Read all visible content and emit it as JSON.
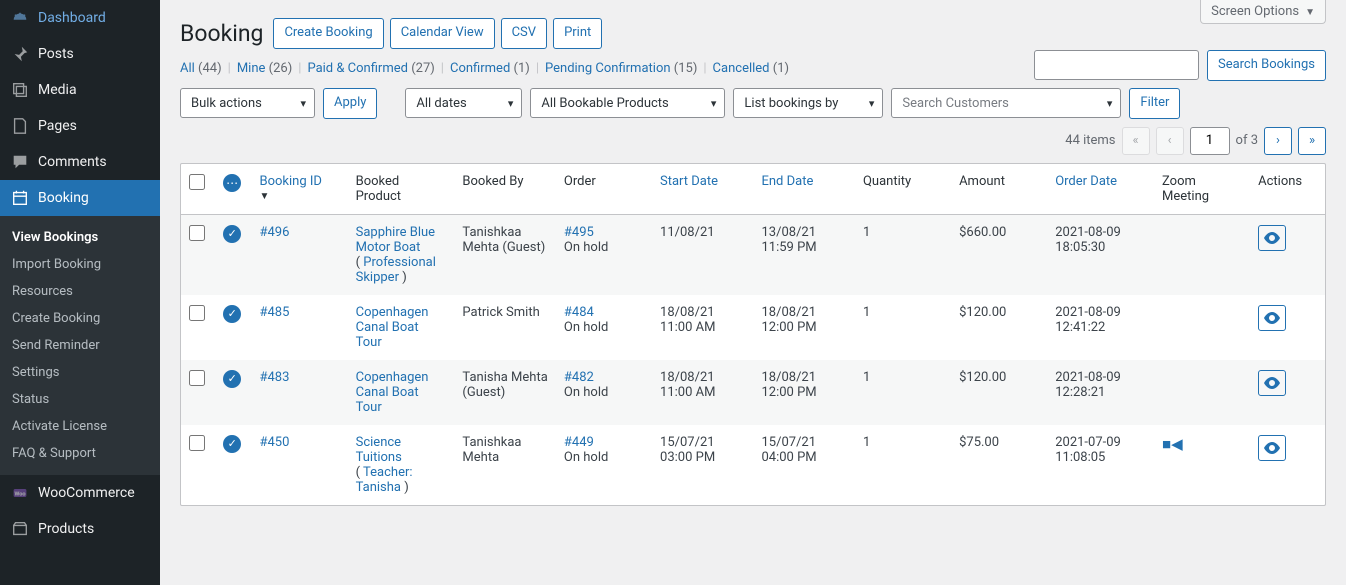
{
  "screen_options": "Screen Options",
  "sidebar": {
    "items": [
      {
        "label": "Dashboard",
        "icon": "dashboard"
      },
      {
        "label": "Posts",
        "icon": "pin"
      },
      {
        "label": "Media",
        "icon": "media"
      },
      {
        "label": "Pages",
        "icon": "pages"
      },
      {
        "label": "Comments",
        "icon": "comments"
      },
      {
        "label": "Booking",
        "icon": "calendar",
        "active": true
      },
      {
        "label": "WooCommerce",
        "icon": "woo"
      },
      {
        "label": "Products",
        "icon": "products"
      }
    ],
    "sub": [
      {
        "label": "View Bookings",
        "active": true
      },
      {
        "label": "Import Booking"
      },
      {
        "label": "Resources"
      },
      {
        "label": "Create Booking"
      },
      {
        "label": "Send Reminder"
      },
      {
        "label": "Settings"
      },
      {
        "label": "Status"
      },
      {
        "label": "Activate License"
      },
      {
        "label": "FAQ & Support"
      }
    ]
  },
  "page": {
    "title": "Booking",
    "buttons": [
      "Create Booking",
      "Calendar View",
      "CSV",
      "Print"
    ]
  },
  "views": [
    {
      "label": "All",
      "count": "(44)"
    },
    {
      "label": "Mine",
      "count": "(26)"
    },
    {
      "label": "Paid & Confirmed",
      "count": "(27)"
    },
    {
      "label": "Confirmed",
      "count": "(1)"
    },
    {
      "label": "Pending Confirmation",
      "count": "(15)"
    },
    {
      "label": "Cancelled",
      "count": "(1)"
    }
  ],
  "search": {
    "placeholder": "",
    "button": "Search Bookings"
  },
  "toolbar": {
    "bulk": "Bulk actions",
    "apply": "Apply",
    "dates": "All dates",
    "products": "All Bookable Products",
    "listby": "List bookings by",
    "customers": "Search Customers",
    "filter": "Filter"
  },
  "pager": {
    "items": "44 items",
    "current": "1",
    "of": "of 3"
  },
  "columns": {
    "booking_id": "Booking ID",
    "booked_product": "Booked Product",
    "booked_by": "Booked By",
    "order": "Order",
    "start_date": "Start Date",
    "end_date": "End Date",
    "quantity": "Quantity",
    "amount": "Amount",
    "order_date": "Order Date",
    "zoom": "Zoom Meeting",
    "actions": "Actions"
  },
  "rows": [
    {
      "id": "#496",
      "product": "Sapphire Blue Motor Boat",
      "product_extra_pre": "( ",
      "product_extra": "Professional Skipper",
      "product_extra_post": " )",
      "by": "Tanishkaa Mehta (Guest)",
      "order": "#495",
      "order_status": "On hold",
      "start": "11/08/21",
      "start_t": "",
      "end": "13/08/21",
      "end_t": "11:59 PM",
      "qty": "1",
      "amount": "$660.00",
      "odate": "2021-08-09",
      "otime": "18:05:30",
      "zoom": false
    },
    {
      "id": "#485",
      "product": "Copenhagen Canal Boat Tour",
      "by": "Patrick Smith",
      "order": "#484",
      "order_status": "On hold",
      "start": "18/08/21",
      "start_t": "11:00 AM",
      "end": "18/08/21",
      "end_t": "12:00 PM",
      "qty": "1",
      "amount": "$120.00",
      "odate": "2021-08-09",
      "otime": "12:41:22",
      "zoom": false
    },
    {
      "id": "#483",
      "product": "Copenhagen Canal Boat Tour",
      "by": "Tanisha Mehta (Guest)",
      "order": "#482",
      "order_status": "On hold",
      "start": "18/08/21",
      "start_t": "11:00 AM",
      "end": "18/08/21",
      "end_t": "12:00 PM",
      "qty": "1",
      "amount": "$120.00",
      "odate": "2021-08-09",
      "otime": "12:28:21",
      "zoom": false
    },
    {
      "id": "#450",
      "product": "Science Tuitions",
      "product_extra_pre": " ( ",
      "product_extra": "Teacher: Tanisha",
      "product_extra_post": " )",
      "by": "Tanishkaa Mehta",
      "order": "#449",
      "order_status": "On hold",
      "start": "15/07/21",
      "start_t": "03:00 PM",
      "end": "15/07/21",
      "end_t": "04:00 PM",
      "qty": "1",
      "amount": "$75.00",
      "odate": "2021-07-09",
      "otime": "11:08:05",
      "zoom": true
    }
  ]
}
